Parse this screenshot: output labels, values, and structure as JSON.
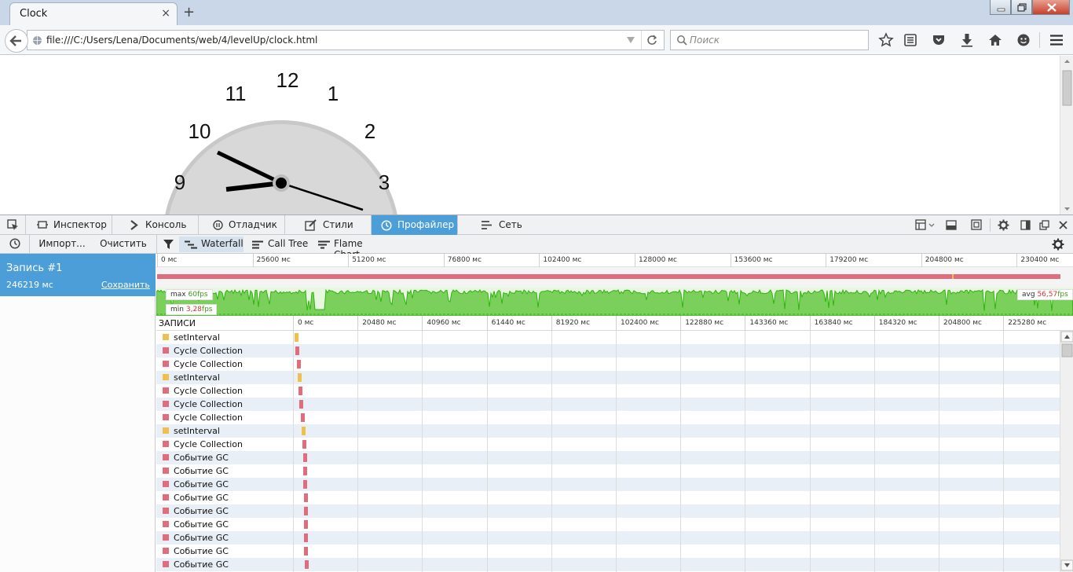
{
  "browser": {
    "tab_title": "Clock",
    "tab_close": "×",
    "new_tab": "+",
    "url": "file:///C:/Users/Lena/Documents/web/4/levelUp/clock.html",
    "search_placeholder": "Поиск"
  },
  "clock": {
    "numbers": [
      "12",
      "1",
      "2",
      "3",
      "9",
      "10",
      "11"
    ]
  },
  "devtools": {
    "tabs": [
      {
        "label": "Инспектор",
        "icon": "inspector-icon"
      },
      {
        "label": "Консоль",
        "icon": "console-icon"
      },
      {
        "label": "Отладчик",
        "icon": "debugger-icon"
      },
      {
        "label": "Стили",
        "icon": "style-editor-icon"
      },
      {
        "label": "Профайлер",
        "icon": "profiler-icon",
        "active": true
      },
      {
        "label": "Сеть",
        "icon": "network-icon"
      }
    ]
  },
  "profiler": {
    "toolbar": {
      "import": "Импорт...",
      "clear": "Очистить",
      "views": [
        "Waterfall",
        "Call Tree",
        "Flame Chart"
      ],
      "selected_view": "Waterfall"
    },
    "recording": {
      "title": "Запись #1",
      "duration": "246219 мс",
      "save": "Сохранить"
    },
    "overview_ticks": [
      "0 мс",
      "25600 мс",
      "51200 мс",
      "76800 мс",
      "102400 мс",
      "128000 мс",
      "153600 мс",
      "179200 мс",
      "204800 мс",
      "230400 мс"
    ],
    "fps": {
      "max_label": "max",
      "max_value": "60",
      "min_label": "min",
      "min_value": "3,28",
      "avg_label": "avg",
      "avg_value": "56,57",
      "unit": "fps"
    },
    "waterfall": {
      "header": "ЗАПИСИ",
      "ticks": [
        "0 мс",
        "20480 мс",
        "40960 мс",
        "61440 мс",
        "81920 мс",
        "102400 мс",
        "122880 мс",
        "143360 мс",
        "163840 мс",
        "184320 мс",
        "204800 мс",
        "225280 мс"
      ],
      "colors": {
        "timer": "#f0c04c",
        "gc": "#e06c7c"
      },
      "rows": [
        {
          "name": "setInterval",
          "kind": "timer",
          "t": 200
        },
        {
          "name": "Cycle Collection",
          "kind": "gc",
          "t": 450
        },
        {
          "name": "Cycle Collection",
          "kind": "gc",
          "t": 1100
        },
        {
          "name": "setInterval",
          "kind": "timer",
          "t": 1300
        },
        {
          "name": "Cycle Collection",
          "kind": "gc",
          "t": 1400
        },
        {
          "name": "Cycle Collection",
          "kind": "gc",
          "t": 1800
        },
        {
          "name": "Cycle Collection",
          "kind": "gc",
          "t": 2200
        },
        {
          "name": "setInterval",
          "kind": "timer",
          "t": 2500
        },
        {
          "name": "Cycle Collection",
          "kind": "gc",
          "t": 2700
        },
        {
          "name": "Событие GC",
          "kind": "gc",
          "t": 3000
        },
        {
          "name": "Событие GC",
          "kind": "gc",
          "t": 3050
        },
        {
          "name": "Событие GC",
          "kind": "gc",
          "t": 3100
        },
        {
          "name": "Событие GC",
          "kind": "gc",
          "t": 3150
        },
        {
          "name": "Событие GC",
          "kind": "gc",
          "t": 3200
        },
        {
          "name": "Событие GC",
          "kind": "gc",
          "t": 3250
        },
        {
          "name": "Событие GC",
          "kind": "gc",
          "t": 3300
        },
        {
          "name": "Событие GC",
          "kind": "gc",
          "t": 3350
        },
        {
          "name": "Событие GC",
          "kind": "gc",
          "t": 3400
        }
      ]
    }
  }
}
